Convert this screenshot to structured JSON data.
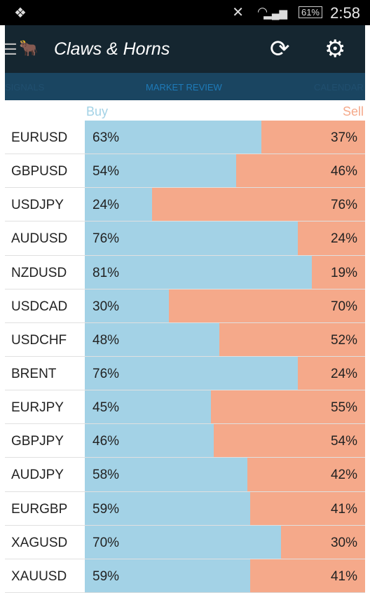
{
  "status": {
    "time": "2:58",
    "battery": "61%"
  },
  "header": {
    "title": "Claws & Horns"
  },
  "tabs": [
    "SIGNALS",
    "MARKET REVIEW",
    "CALENDAR"
  ],
  "legend": {
    "buy": "Buy",
    "sell": "Sell"
  },
  "colors": {
    "buy": "#a3d2e6",
    "sell": "#f5a98a",
    "header": "#152630",
    "tabs": "#1a4561"
  },
  "rows": [
    {
      "pair": "EURUSD",
      "buy": 63,
      "sell": 37
    },
    {
      "pair": "GBPUSD",
      "buy": 54,
      "sell": 46
    },
    {
      "pair": "USDJPY",
      "buy": 24,
      "sell": 76
    },
    {
      "pair": "AUDUSD",
      "buy": 76,
      "sell": 24
    },
    {
      "pair": "NZDUSD",
      "buy": 81,
      "sell": 19
    },
    {
      "pair": "USDCAD",
      "buy": 30,
      "sell": 70
    },
    {
      "pair": "USDCHF",
      "buy": 48,
      "sell": 52
    },
    {
      "pair": "BRENT",
      "buy": 76,
      "sell": 24
    },
    {
      "pair": "EURJPY",
      "buy": 45,
      "sell": 55
    },
    {
      "pair": "GBPJPY",
      "buy": 46,
      "sell": 54
    },
    {
      "pair": "AUDJPY",
      "buy": 58,
      "sell": 42
    },
    {
      "pair": "EURGBP",
      "buy": 59,
      "sell": 41
    },
    {
      "pair": "XAGUSD",
      "buy": 70,
      "sell": 30
    },
    {
      "pair": "XAUUSD",
      "buy": 59,
      "sell": 41
    }
  ]
}
